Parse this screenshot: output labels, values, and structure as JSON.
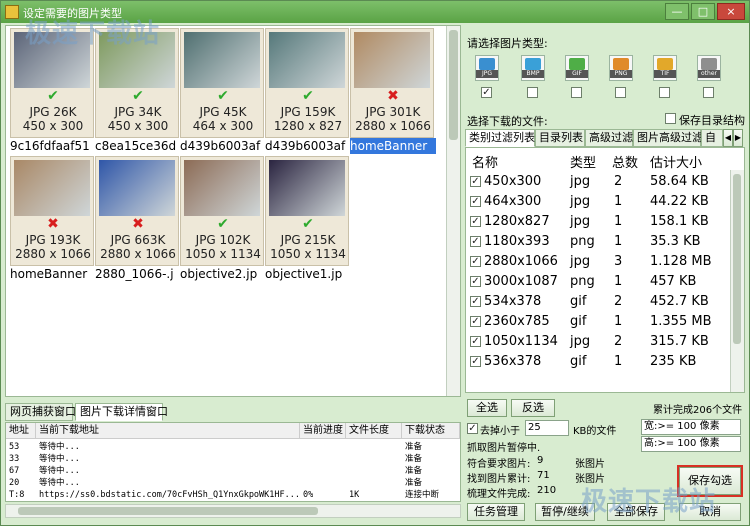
{
  "window": {
    "title": "设定需要的图片类型",
    "min_label": "—",
    "max_label": "□",
    "close_label": "×"
  },
  "gallery": {
    "tiles": [
      {
        "info1": "JPG 26K",
        "info2": "450 x 300",
        "name": "9c16fdfaaf51",
        "status": "ok",
        "thumb_color": "#5b6478"
      },
      {
        "info1": "JPG 34K",
        "info2": "450 x 300",
        "name": "c8ea15ce36d",
        "status": "ok",
        "thumb_color": "#7e9a5e"
      },
      {
        "info1": "JPG 45K",
        "info2": "464 x 300",
        "name": "d439b6003af",
        "status": "ok",
        "thumb_color": "#4f6f70"
      },
      {
        "info1": "JPG 159K",
        "info2": "1280 x 827",
        "name": "d439b6003af",
        "status": "ok",
        "thumb_color": "#55787a"
      },
      {
        "info1": "JPG 301K",
        "info2": "2880 x 1066",
        "name": "homeBanner",
        "status": "bad",
        "thumb_color": "#b08a62",
        "selected": true
      },
      {
        "info1": "JPG 193K",
        "info2": "2880 x 1066",
        "name": "homeBanner",
        "status": "bad",
        "thumb_color": "#a98866"
      },
      {
        "info1": "JPG 663K",
        "info2": "2880 x 1066",
        "name": "2880_1066-.j",
        "status": "bad",
        "thumb_color": "#2f56a8"
      },
      {
        "info1": "JPG 102K",
        "info2": "1050 x 1134",
        "name": "objective2.jp",
        "status": "ok",
        "thumb_color": "#8c6b55"
      },
      {
        "info1": "JPG 215K",
        "info2": "1050 x 1134",
        "name": "objective1.jp",
        "status": "ok",
        "thumb_color": "#2a2440"
      }
    ]
  },
  "bottom": {
    "tabs": [
      "网页捕获窗口",
      "图片下载详情窗口"
    ],
    "headers": [
      "地址",
      "当前下载地址",
      "当前进度",
      "文件长度",
      "下载状态"
    ],
    "rows": [
      {
        "id": "53",
        "url": "等待中...",
        "progress": "",
        "length": "",
        "status": "准备"
      },
      {
        "id": "33",
        "url": "等待中...",
        "progress": "",
        "length": "",
        "status": "准备"
      },
      {
        "id": "67",
        "url": "等待中...",
        "progress": "",
        "length": "",
        "status": "准备"
      },
      {
        "id": "20",
        "url": "等待中...",
        "progress": "",
        "length": "",
        "status": "准备"
      },
      {
        "id": "T:8",
        "url": "https://ss0.bdstatic.com/70cFvHSh_Q1YnxGkpoWK1HF...",
        "progress": "0%",
        "length": "1K",
        "status": "连接中断"
      }
    ]
  },
  "right": {
    "choose_type_label": "请选择图片类型:",
    "types": [
      {
        "label": "JPG",
        "color": "#3a8fd0",
        "checked": true
      },
      {
        "label": "BMP",
        "color": "#3aa0d8",
        "checked": false
      },
      {
        "label": "GIF",
        "color": "#4fae47",
        "checked": false
      },
      {
        "label": "PNG",
        "color": "#e08a2a",
        "checked": false
      },
      {
        "label": "TIF",
        "color": "#e2a82a",
        "checked": false
      },
      {
        "label": "other",
        "color": "#8e8e8e",
        "checked": false
      }
    ],
    "select_files_label": "选择下载的文件:",
    "keep_dir_label": "保存目录结构",
    "tabs": [
      "类别过滤列表",
      "目录列表",
      "高级过滤",
      "图片高级过滤",
      "自"
    ],
    "columns": [
      "名称",
      "类型",
      "总数",
      "估计大小"
    ],
    "rows": [
      {
        "name": "450x300",
        "type": "jpg",
        "count": "2",
        "size": "58.64 KB"
      },
      {
        "name": "464x300",
        "type": "jpg",
        "count": "1",
        "size": "44.22 KB"
      },
      {
        "name": "1280x827",
        "type": "jpg",
        "count": "1",
        "size": "158.1 KB"
      },
      {
        "name": "1180x393",
        "type": "png",
        "count": "1",
        "size": "35.3 KB"
      },
      {
        "name": "2880x1066",
        "type": "jpg",
        "count": "3",
        "size": "1.128 MB"
      },
      {
        "name": "3000x1087",
        "type": "png",
        "count": "1",
        "size": "457 KB"
      },
      {
        "name": "534x378",
        "type": "gif",
        "count": "2",
        "size": "452.7 KB"
      },
      {
        "name": "2360x785",
        "type": "gif",
        "count": "1",
        "size": "1.355 MB"
      },
      {
        "name": "1050x1134",
        "type": "jpg",
        "count": "2",
        "size": "315.7 KB"
      },
      {
        "name": "536x378",
        "type": "gif",
        "count": "1",
        "size": "235 KB"
      }
    ],
    "select_all": "全选",
    "invert": "反选",
    "accum_done": "累计完成206个文件",
    "remove_small_label": "去掉小于",
    "remove_small_value": "25",
    "kb_label": "KB的文件",
    "width_filter": "宽:>= 100 像素",
    "height_filter": "高:>= 100 像素",
    "pause_info": "抓取图片暂停中.",
    "stats": [
      {
        "label": "符合要求图片:",
        "value": "9",
        "unit": "张图片"
      },
      {
        "label": "找到图片累计:",
        "value": "71",
        "unit": "张图片"
      },
      {
        "label": "梳理文件完成:",
        "value": "210",
        "unit": ""
      }
    ],
    "task_btn": "任务管理",
    "pause_btn": "暂停/继续",
    "save_all_btn": "全部保存",
    "save_checked_btn": "保存勾选",
    "cancel_btn": "取消"
  },
  "watermark": {
    "text": "极速下载站"
  }
}
